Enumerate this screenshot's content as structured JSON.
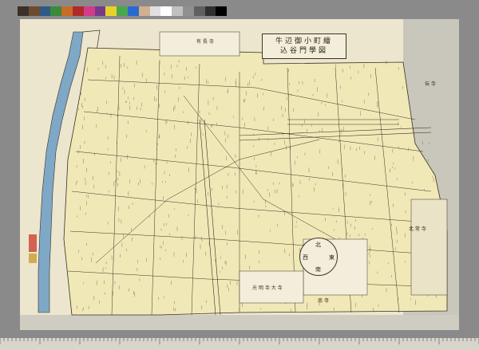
{
  "title": {
    "line1": "牛辺御小町繪",
    "line2": "込谷門學図"
  },
  "compass": {
    "north": "北",
    "south": "南",
    "east": "東",
    "west": "西"
  },
  "labels": {
    "top_center": "有 長 寺",
    "right_top": "伝 寺",
    "right_mid": "北 常 寺",
    "bottom_center": "光 明 寺 大 寺",
    "bottom_mid": "南 寺"
  },
  "colors": {
    "paper": "#ece6cf",
    "water": "#7fa8c6",
    "ink": "#3a2f1f",
    "shade": "#b9b7b0"
  },
  "swatches": [
    "#3b2f2a",
    "#6e4b2e",
    "#2d5a86",
    "#3a8a3a",
    "#c86c2a",
    "#b02a2a",
    "#d33b8a",
    "#7a3a8a",
    "#e8d22a",
    "#4aa84a",
    "#2a6ad0",
    "#d0b090",
    "#e0e0e0",
    "#ffffff",
    "#c0c0c0",
    "#909090",
    "#606060",
    "#303030",
    "#000000"
  ]
}
